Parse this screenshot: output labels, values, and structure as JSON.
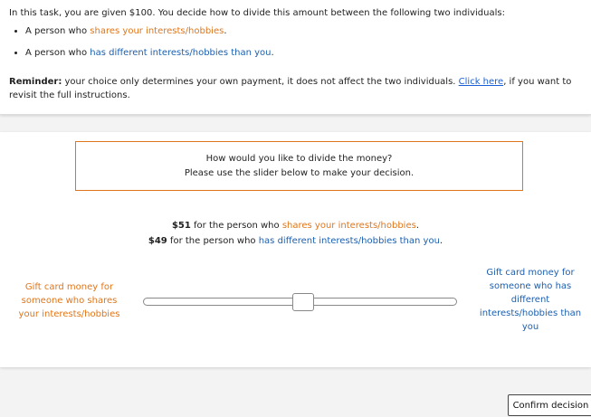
{
  "instructions": {
    "intro": "In this task, you are given $100. You decide how to divide this amount between the following two individuals:",
    "option1_prefix": "A person who ",
    "option1_highlight": "shares your interests/hobbies",
    "option1_suffix": ".",
    "option2_prefix": "A person who ",
    "option2_highlight": "has different interests/hobbies than you",
    "option2_suffix": ".",
    "reminder_label": "Reminder:",
    "reminder_text": " your choice only determines your own payment, it does not affect the two individuals. ",
    "reminder_link": "Click here",
    "reminder_tail": ", if you want to revisit the full instructions."
  },
  "decision": {
    "prompt_line1": "How would you like to divide the money?",
    "prompt_line2": "Please use the slider below to make your decision.",
    "alloc1_amount": "$51",
    "alloc1_text": " for the person who ",
    "alloc1_highlight": "shares your interests/hobbies",
    "alloc1_suffix": ".",
    "alloc2_amount": "$49",
    "alloc2_text": " for the person who ",
    "alloc2_highlight": "has different interests/hobbies than you",
    "alloc2_suffix": ".",
    "left_label": "Gift card money for someone who shares your interests/hobbies",
    "right_label": "Gift card money for someone who has different interests/hobbies than you",
    "slider_value": 51,
    "slider_min": 0,
    "slider_max": 100
  },
  "confirm_label": "Confirm decision",
  "colors": {
    "orange": "#e0761b",
    "blue": "#1d5fae",
    "link": "#1a5fd6"
  }
}
